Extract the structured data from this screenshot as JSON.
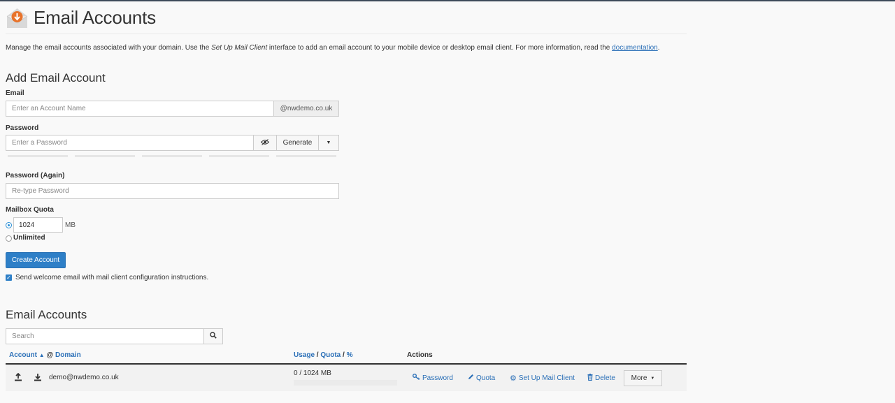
{
  "header": {
    "title": "Email Accounts",
    "icon": "email-accounts-icon"
  },
  "intro": {
    "part1": "Manage the email accounts associated with your domain. Use the ",
    "emph": "Set Up Mail Client",
    "part2": " interface to add an email account to your mobile device or desktop email client. For more information, read the ",
    "link": "documentation",
    "part3": "."
  },
  "add_account": {
    "heading": "Add Email Account",
    "email_label": "Email",
    "email_placeholder": "Enter an Account Name",
    "domain_suffix": "@nwdemo.co.uk",
    "password_label": "Password",
    "password_placeholder": "Enter a Password",
    "generate_label": "Generate",
    "password_again_label": "Password (Again)",
    "password_again_placeholder": "Re-type Password",
    "quota_label": "Mailbox Quota",
    "quota_value": "1024",
    "quota_unit": "MB",
    "unlimited_label": "Unlimited",
    "create_button": "Create Account",
    "welcome_label": "Send welcome email with mail client configuration instructions."
  },
  "accounts": {
    "heading": "Email Accounts",
    "search_placeholder": "Search",
    "columns": {
      "account": "Account",
      "sort_arrow": "▲",
      "at": "@",
      "domain": "Domain",
      "usage": "Usage",
      "slash": "/",
      "quota": "Quota",
      "percent": "%",
      "actions": "Actions"
    },
    "rows": [
      {
        "email": "demo@nwdemo.co.uk",
        "usage": "0 / 1024 MB",
        "usage_fraction": 0,
        "actions": {
          "password": "Password",
          "quota": "Quota",
          "setup": "Set Up Mail Client",
          "delete": "Delete",
          "more": "More"
        }
      }
    ]
  },
  "colors": {
    "primary": "#2e7fc7",
    "link": "#2a6fb7",
    "brand_orange": "#e8732b"
  }
}
